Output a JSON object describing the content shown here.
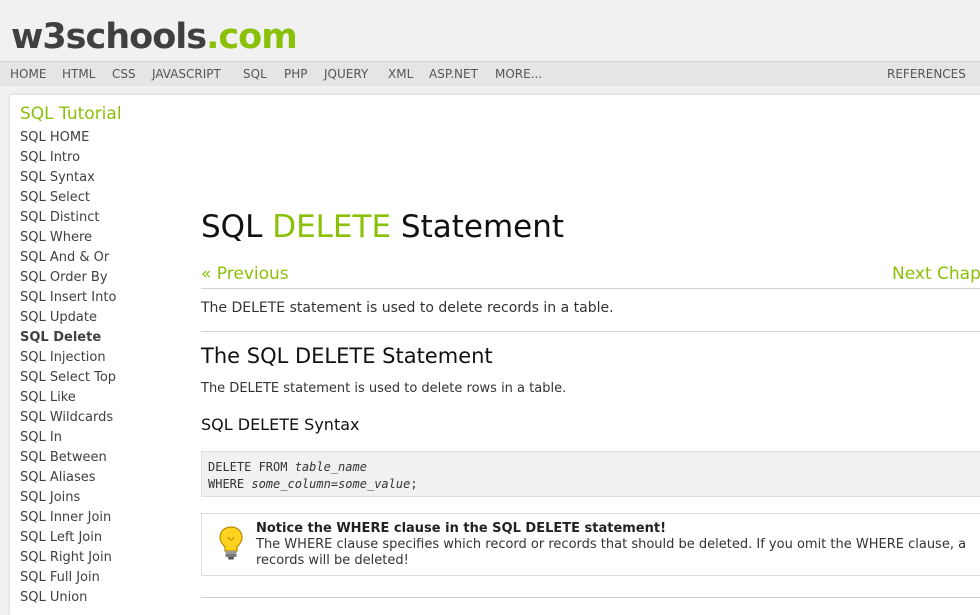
{
  "logo": {
    "w3": "w3schools",
    "com": ".com"
  },
  "topnav": {
    "items": [
      "HOME",
      "HTML",
      "CSS",
      "JAVASCRIPT",
      "SQL",
      "PHP",
      "JQUERY",
      "XML",
      "ASP.NET",
      "MORE..."
    ],
    "right": "REFERENCES"
  },
  "sidebar": {
    "title": "SQL Tutorial",
    "items": [
      "SQL HOME",
      "SQL Intro",
      "SQL Syntax",
      "SQL Select",
      "SQL Distinct",
      "SQL Where",
      "SQL And & Or",
      "SQL Order By",
      "SQL Insert Into",
      "SQL Update",
      "SQL Delete",
      "SQL Injection",
      "SQL Select Top",
      "SQL Like",
      "SQL Wildcards",
      "SQL In",
      "SQL Between",
      "SQL Aliases",
      "SQL Joins",
      "SQL Inner Join",
      "SQL Left Join",
      "SQL Right Join",
      "SQL Full Join",
      "SQL Union"
    ],
    "active": "SQL Delete"
  },
  "main": {
    "title_pre": "SQL ",
    "title_kw": "DELETE",
    "title_post": " Statement",
    "prev": "« Previous",
    "next": "Next Chap",
    "intro": "The DELETE statement is used to delete records in a table.",
    "h2": "The SQL DELETE Statement",
    "p2": "The DELETE statement is used to delete rows in a table.",
    "h3": "SQL DELETE Syntax",
    "code": {
      "l1_kw": "DELETE FROM ",
      "l1_var": "table_name",
      "l2_kw": "WHERE ",
      "l2_var1": "some_column",
      "l2_eq": "=",
      "l2_var2": "some_value",
      "l2_end": ";"
    },
    "notice": {
      "title": "Notice the WHERE clause in the SQL DELETE statement!",
      "text": "The WHERE clause specifies which record or records that should be deleted. If you omit the WHERE clause, a records will be deleted!"
    }
  },
  "colors": {
    "accent": "#8ac007",
    "text": "#404040",
    "bg": "#f1f1f1"
  }
}
